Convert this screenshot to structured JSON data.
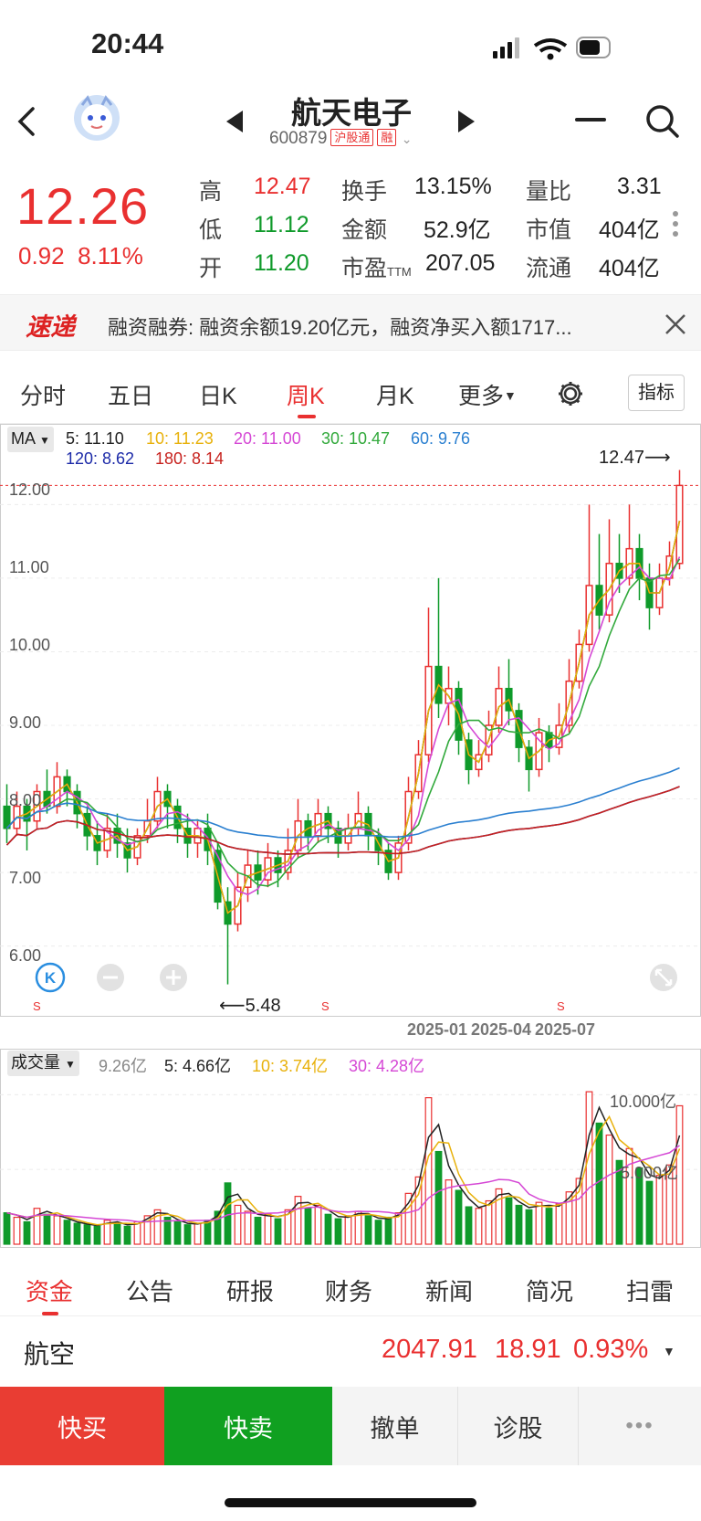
{
  "status": {
    "time": "20:44"
  },
  "header": {
    "name": "航天电子",
    "code": "600879",
    "tags": [
      "沪股通",
      "融"
    ]
  },
  "quote": {
    "price": "12.26",
    "change": "0.92",
    "change_pct": "8.11%",
    "high_label": "高",
    "high": "12.47",
    "low_label": "低",
    "low": "11.12",
    "open_label": "开",
    "open": "11.20",
    "turnover_label": "换手",
    "turnover": "13.15%",
    "amount_label": "金额",
    "amount": "52.9亿",
    "pe_label": "市盈",
    "pe_sub": "TTM",
    "pe": "207.05",
    "vol_ratio_label": "量比",
    "vol_ratio": "3.31",
    "mcap_label": "市值",
    "mcap": "404亿",
    "float_label": "流通",
    "float": "404亿"
  },
  "news": {
    "logo": "速递",
    "text": "融资融券: 融资余额19.20亿元，融资净买入额1717..."
  },
  "tabs": [
    "分时",
    "五日",
    "日K",
    "周K",
    "月K",
    "更多"
  ],
  "indicator_button": "指标",
  "chart": {
    "ma_selector": "MA",
    "ma": [
      {
        "label": "5: 11.10",
        "color": "#222222"
      },
      {
        "label": "10: 11.23",
        "color": "#e8b10b"
      },
      {
        "label": "20: 11.00",
        "color": "#d548d5"
      },
      {
        "label": "30: 10.47",
        "color": "#31a93b"
      },
      {
        "label": "60: 9.76",
        "color": "#2a7fd0"
      },
      {
        "label": "120: 8.62",
        "color": "#1c2aa8"
      },
      {
        "label": "180: 8.14",
        "color": "#c7221e"
      }
    ],
    "yticks": [
      "12.00",
      "11.00",
      "10.00",
      "9.00",
      "8.00",
      "7.00",
      "6.00"
    ],
    "max_label": "12.47",
    "min_label": "5.48",
    "s_marks": [
      "S",
      "S",
      "S"
    ],
    "date_labels": [
      "2025-01",
      "2025-04",
      "2025-07"
    ]
  },
  "volume": {
    "selector": "成交量",
    "current": "9.26亿",
    "ma": [
      {
        "label": "5: 4.66亿",
        "color": "#222222"
      },
      {
        "label": "10: 3.74亿",
        "color": "#e8b10b"
      },
      {
        "label": "30: 4.28亿",
        "color": "#d548d5"
      }
    ],
    "yticks": [
      "10.000亿",
      "5.000亿"
    ]
  },
  "chart_data": {
    "type": "candlestick",
    "title": "航天电子 周K",
    "ylim": [
      5.4,
      12.6
    ],
    "candles": [
      [
        7.9,
        7.6,
        8.2,
        7.4
      ],
      [
        7.6,
        7.9,
        8.1,
        7.5
      ],
      [
        7.9,
        7.7,
        8.0,
        7.3
      ],
      [
        7.7,
        8.1,
        8.2,
        7.6
      ],
      [
        8.1,
        7.9,
        8.4,
        7.8
      ],
      [
        7.9,
        8.3,
        8.5,
        7.8
      ],
      [
        8.3,
        8.1,
        8.4,
        7.9
      ],
      [
        8.1,
        7.8,
        8.2,
        7.6
      ],
      [
        7.8,
        7.5,
        7.9,
        7.3
      ],
      [
        7.5,
        7.3,
        7.7,
        7.1
      ],
      [
        7.3,
        7.6,
        7.8,
        7.2
      ],
      [
        7.6,
        7.4,
        7.8,
        7.2
      ],
      [
        7.4,
        7.2,
        7.6,
        7.0
      ],
      [
        7.2,
        7.5,
        7.6,
        7.1
      ],
      [
        7.5,
        7.7,
        8.0,
        7.4
      ],
      [
        7.7,
        8.1,
        8.3,
        7.6
      ],
      [
        8.1,
        7.9,
        8.2,
        7.6
      ],
      [
        7.9,
        7.6,
        8.0,
        7.4
      ],
      [
        7.6,
        7.4,
        7.8,
        7.2
      ],
      [
        7.4,
        7.6,
        7.7,
        7.2
      ],
      [
        7.6,
        7.3,
        7.8,
        7.1
      ],
      [
        7.3,
        6.6,
        7.4,
        6.5
      ],
      [
        6.6,
        6.3,
        6.8,
        5.48
      ],
      [
        6.3,
        6.8,
        7.0,
        6.2
      ],
      [
        6.8,
        7.1,
        7.3,
        6.6
      ],
      [
        7.1,
        6.9,
        7.3,
        6.7
      ],
      [
        6.9,
        7.2,
        7.4,
        6.8
      ],
      [
        7.2,
        7.0,
        7.3,
        6.8
      ],
      [
        7.0,
        7.3,
        7.6,
        6.9
      ],
      [
        7.3,
        7.7,
        8.0,
        7.2
      ],
      [
        7.7,
        7.5,
        7.8,
        7.3
      ],
      [
        7.5,
        7.8,
        8.0,
        7.4
      ],
      [
        7.8,
        7.6,
        7.9,
        7.4
      ],
      [
        7.6,
        7.4,
        7.7,
        7.2
      ],
      [
        7.4,
        7.6,
        7.8,
        7.3
      ],
      [
        7.6,
        7.8,
        8.1,
        7.5
      ],
      [
        7.8,
        7.5,
        7.9,
        7.3
      ],
      [
        7.5,
        7.3,
        7.6,
        7.1
      ],
      [
        7.3,
        7.0,
        7.4,
        6.9
      ],
      [
        7.0,
        7.4,
        7.5,
        6.9
      ],
      [
        7.4,
        8.1,
        8.3,
        7.3
      ],
      [
        8.1,
        8.6,
        8.8,
        8.0
      ],
      [
        8.6,
        9.8,
        10.6,
        8.5
      ],
      [
        9.8,
        9.3,
        11.0,
        9.1
      ],
      [
        9.3,
        9.5,
        9.8,
        9.0
      ],
      [
        9.5,
        8.8,
        9.6,
        8.6
      ],
      [
        8.8,
        8.4,
        8.9,
        8.2
      ],
      [
        8.4,
        8.6,
        8.8,
        8.3
      ],
      [
        8.6,
        9.0,
        9.2,
        8.5
      ],
      [
        9.0,
        9.5,
        9.8,
        8.9
      ],
      [
        9.5,
        9.2,
        9.9,
        9.0
      ],
      [
        9.2,
        8.7,
        9.3,
        8.5
      ],
      [
        8.7,
        8.4,
        8.8,
        8.1
      ],
      [
        8.4,
        8.9,
        9.1,
        8.3
      ],
      [
        8.9,
        8.7,
        9.0,
        8.5
      ],
      [
        8.7,
        9.0,
        9.3,
        8.6
      ],
      [
        9.0,
        9.6,
        9.9,
        8.9
      ],
      [
        9.6,
        10.1,
        10.3,
        9.5
      ],
      [
        10.1,
        10.9,
        12.0,
        10.0
      ],
      [
        10.9,
        10.5,
        11.6,
        10.3
      ],
      [
        10.5,
        11.2,
        11.8,
        10.4
      ],
      [
        11.2,
        11.0,
        11.6,
        10.8
      ],
      [
        11.0,
        11.4,
        12.0,
        10.9
      ],
      [
        11.4,
        11.0,
        11.6,
        10.7
      ],
      [
        11.0,
        10.6,
        11.2,
        10.3
      ],
      [
        10.6,
        11.0,
        11.2,
        10.5
      ],
      [
        11.0,
        11.3,
        11.5,
        10.9
      ],
      [
        11.2,
        12.26,
        12.47,
        11.12
      ]
    ],
    "volumes": [
      2.1,
      1.8,
      1.5,
      2.4,
      2.0,
      1.9,
      1.6,
      1.4,
      1.3,
      1.2,
      1.6,
      1.4,
      1.2,
      1.5,
      1.9,
      2.3,
      1.8,
      1.5,
      1.3,
      1.4,
      1.6,
      2.2,
      4.1,
      2.6,
      2.2,
      1.8,
      2.0,
      1.7,
      2.3,
      3.2,
      2.4,
      2.6,
      2.0,
      1.7,
      1.9,
      2.2,
      1.9,
      1.6,
      1.8,
      2.1,
      3.4,
      4.5,
      9.8,
      6.2,
      4.3,
      3.6,
      2.5,
      2.4,
      2.9,
      3.7,
      3.1,
      2.6,
      2.3,
      2.8,
      2.4,
      2.7,
      3.5,
      4.4,
      10.2,
      8.1,
      7.3,
      5.6,
      6.4,
      5.1,
      4.2,
      4.6,
      5.3,
      9.26
    ]
  },
  "bottom_tabs": [
    "资金",
    "公告",
    "研报",
    "财务",
    "新闻",
    "简况",
    "扫雷"
  ],
  "sector": {
    "name": "航空",
    "value": "2047.91",
    "change": "18.91",
    "change_pct": "0.93%"
  },
  "actions": {
    "buy": "快买",
    "sell": "快卖",
    "cancel": "撤单",
    "diagnose": "诊股",
    "more": "•••"
  },
  "colors": {
    "up": "#e93030",
    "down": "#0f9a2a",
    "buy_bg": "#e93d33",
    "sell_bg": "#10a020"
  }
}
